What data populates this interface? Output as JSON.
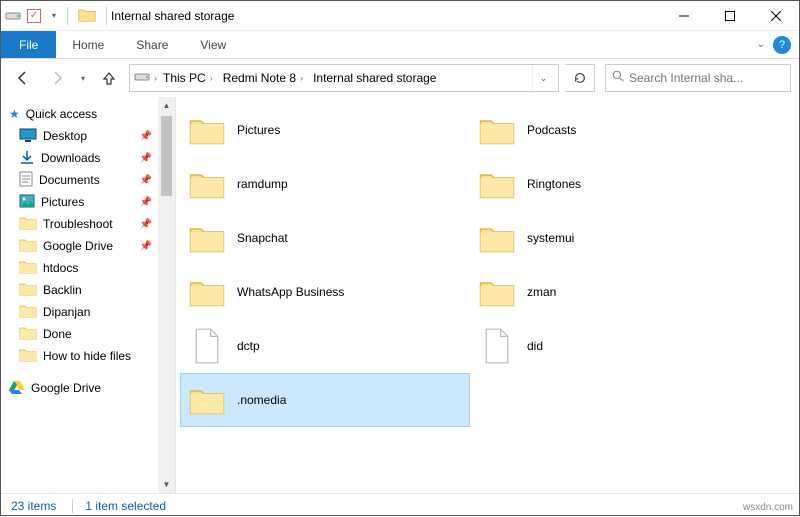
{
  "window": {
    "title": "Internal shared storage"
  },
  "ribbon": {
    "file": "File",
    "tabs": [
      "Home",
      "Share",
      "View"
    ]
  },
  "breadcrumb": [
    "This PC",
    "Redmi Note 8",
    "Internal shared storage"
  ],
  "search": {
    "placeholder": "Search Internal sha..."
  },
  "sidebar": {
    "quick_access": "Quick access",
    "items": [
      {
        "label": "Desktop",
        "icon": "desktop",
        "pinned": true
      },
      {
        "label": "Downloads",
        "icon": "download",
        "pinned": true
      },
      {
        "label": "Documents",
        "icon": "document",
        "pinned": true
      },
      {
        "label": "Pictures",
        "icon": "pictures",
        "pinned": true
      },
      {
        "label": "Troubleshoot",
        "icon": "folder",
        "pinned": true
      },
      {
        "label": "Google Drive",
        "icon": "folder",
        "pinned": true
      },
      {
        "label": "htdocs",
        "icon": "folder",
        "pinned": false
      },
      {
        "label": "Backlin",
        "icon": "folder",
        "pinned": false
      },
      {
        "label": "Dipanjan",
        "icon": "folder",
        "pinned": false
      },
      {
        "label": "Done",
        "icon": "folder",
        "pinned": false
      },
      {
        "label": "How to hide files",
        "icon": "folder",
        "pinned": false
      }
    ],
    "sections": [
      {
        "label": "Google Drive",
        "icon": "gdrive"
      }
    ]
  },
  "items": [
    {
      "name": "Pictures",
      "type": "folder"
    },
    {
      "name": "Podcasts",
      "type": "folder"
    },
    {
      "name": "ramdump",
      "type": "folder"
    },
    {
      "name": "Ringtones",
      "type": "folder"
    },
    {
      "name": "Snapchat",
      "type": "folder"
    },
    {
      "name": "systemui",
      "type": "folder"
    },
    {
      "name": "WhatsApp Business",
      "type": "folder"
    },
    {
      "name": "zman",
      "type": "folder"
    },
    {
      "name": "dctp",
      "type": "file"
    },
    {
      "name": "did",
      "type": "file"
    },
    {
      "name": ".nomedia",
      "type": "folder",
      "selected": true
    }
  ],
  "status": {
    "count": "23 items",
    "selection": "1 item selected"
  },
  "watermark": "wsxdn.com"
}
